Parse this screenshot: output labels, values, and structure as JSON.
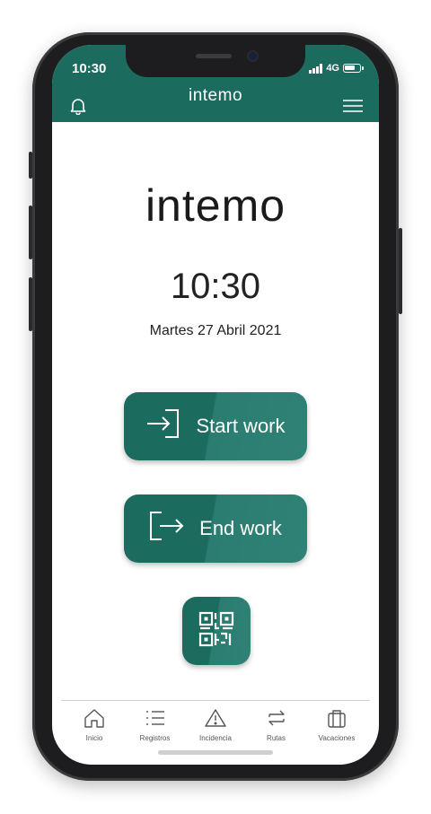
{
  "status_bar": {
    "time": "10:30",
    "network": "4G"
  },
  "header": {
    "title": "intemo"
  },
  "main": {
    "logo": "intemo",
    "clock": "10:30",
    "date": "Martes 27 Abril 2021",
    "start_label": "Start work",
    "end_label": "End work"
  },
  "tabs": [
    {
      "label": "Inicio",
      "icon": "home-icon"
    },
    {
      "label": "Registros",
      "icon": "list-icon"
    },
    {
      "label": "Incidencia",
      "icon": "warning-icon"
    },
    {
      "label": "Rutas",
      "icon": "routes-icon"
    },
    {
      "label": "Vacaciones",
      "icon": "suitcase-icon"
    }
  ],
  "colors": {
    "brand": "#1b6b5e",
    "accent_light": "#2f8275"
  }
}
